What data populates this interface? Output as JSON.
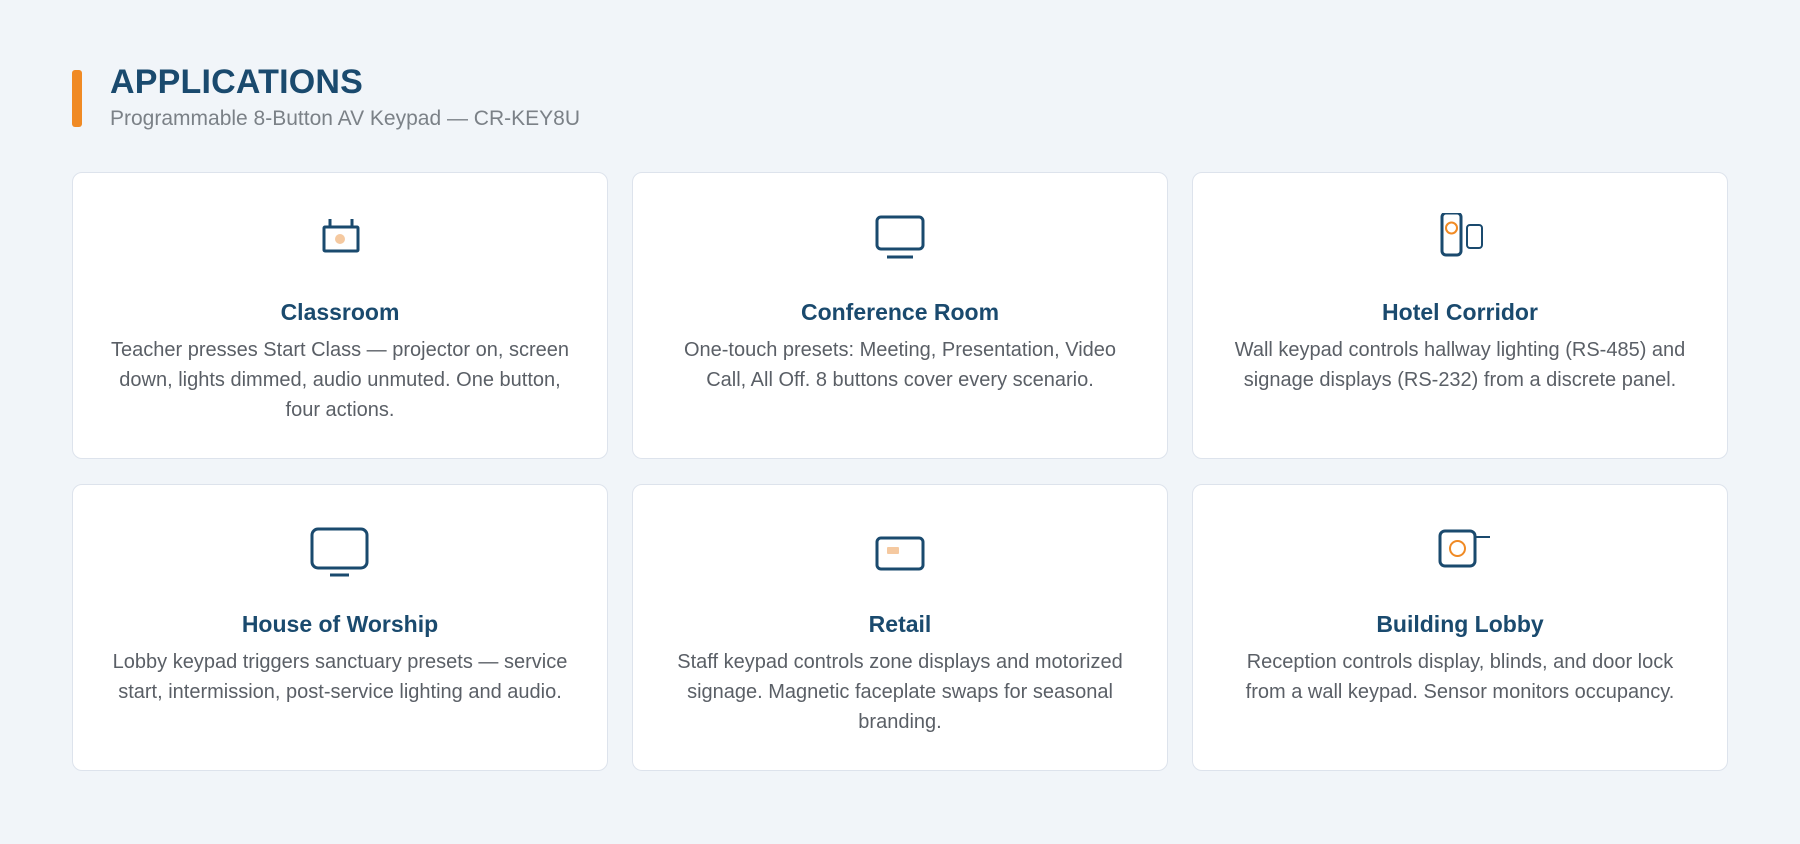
{
  "header": {
    "title": "APPLICATIONS",
    "subtitle": "Programmable 8-Button AV Keypad — CR-KEY8U"
  },
  "colors": {
    "accent": "#f08a24",
    "heading": "#1a4a6e",
    "icon_stroke": "#1a4a6e",
    "icon_highlight_soft": "#f5c9a0"
  },
  "cards": [
    {
      "title": "Classroom",
      "description": "Teacher presses Start Class — projector on, screen down, lights dimmed, audio unmuted. One button, four actions.",
      "icon": "classroom-board-icon"
    },
    {
      "title": "Conference Room",
      "description": "One-touch presets: Meeting, Presentation, Video Call, All Off. 8 buttons cover every scenario.",
      "icon": "monitor-icon"
    },
    {
      "title": "Hotel Corridor",
      "description": "Wall keypad controls hallway lighting (RS-485) and signage displays (RS-232) from a discrete panel.",
      "icon": "keypad-and-panel-icon"
    },
    {
      "title": "House of Worship",
      "description": "Lobby keypad triggers sanctuary presets — service start, intermission, post-service lighting and audio.",
      "icon": "large-display-icon"
    },
    {
      "title": "Retail",
      "description": "Staff keypad controls zone displays and motorized signage. Magnetic faceplate swaps for seasonal branding.",
      "icon": "signage-display-icon"
    },
    {
      "title": "Building Lobby",
      "description": "Reception controls display, blinds, and door lock from a wall keypad. Sensor monitors occupancy.",
      "icon": "wall-keypad-sensor-icon"
    }
  ]
}
